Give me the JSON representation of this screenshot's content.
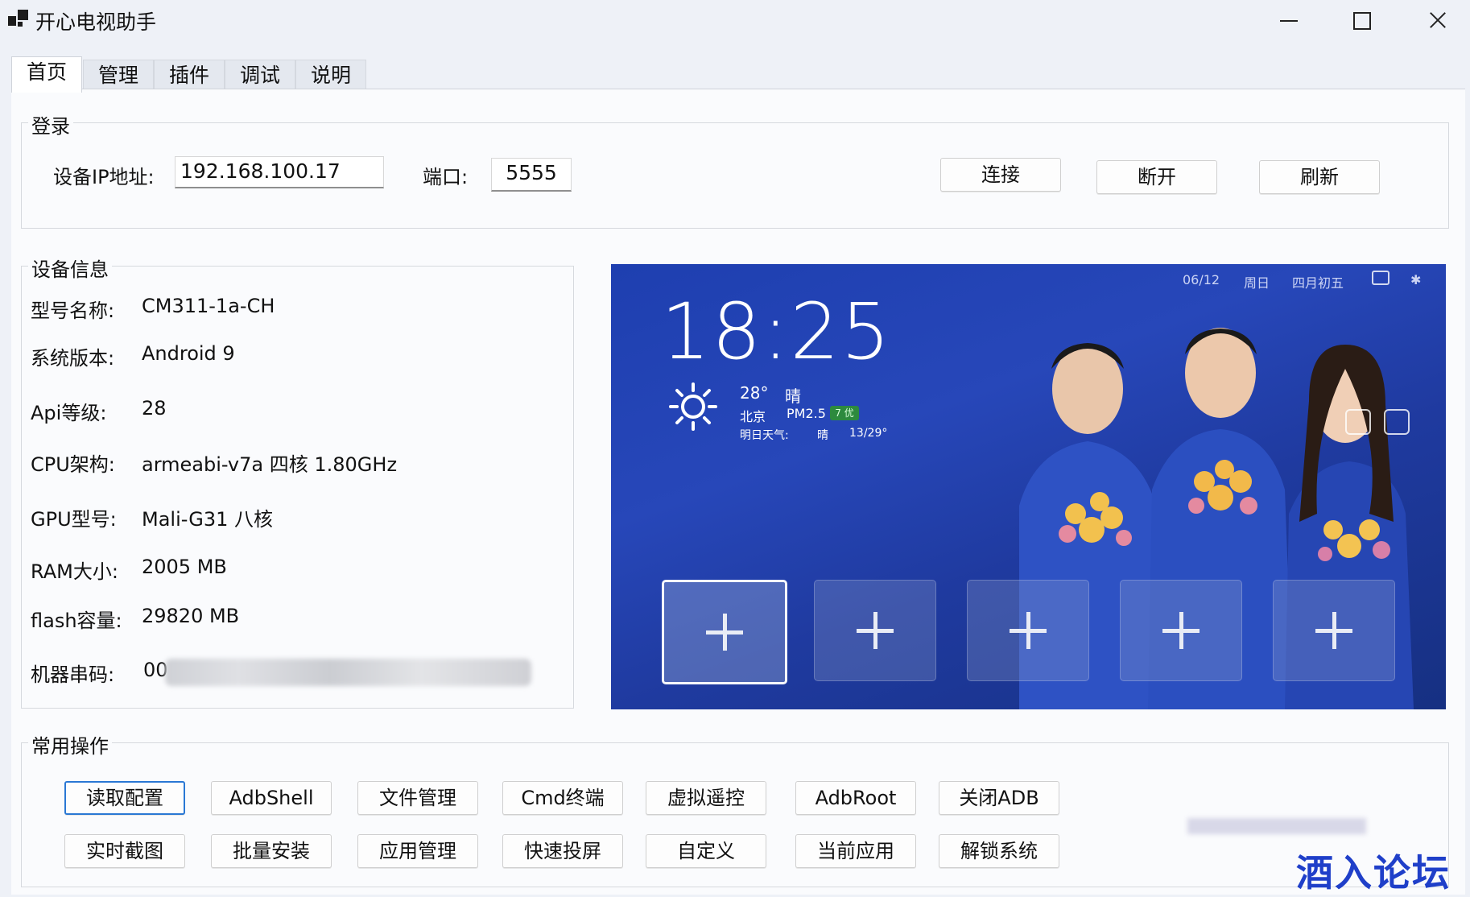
{
  "window": {
    "title": "开心电视助手"
  },
  "tabs": [
    {
      "label": "首页",
      "active": true
    },
    {
      "label": "管理",
      "active": false
    },
    {
      "label": "插件",
      "active": false
    },
    {
      "label": "调试",
      "active": false
    },
    {
      "label": "说明",
      "active": false
    }
  ],
  "login": {
    "group_title": "登录",
    "ip_label": "设备IP地址:",
    "ip_value": "192.168.100.17",
    "port_label": "端口:",
    "port_value": "5555",
    "connect_label": "连接",
    "disconnect_label": "断开",
    "refresh_label": "刷新"
  },
  "device_info": {
    "group_title": "设备信息",
    "rows": [
      {
        "label": "型号名称:",
        "value": "CM311-1a-CH"
      },
      {
        "label": "系统版本:",
        "value": "Android 9"
      },
      {
        "label": "Api等级:",
        "value": "28"
      },
      {
        "label": "CPU架构:",
        "value": "armeabi-v7a 四核 1.80GHz"
      },
      {
        "label": "GPU型号:",
        "value": "Mali-G31 八核"
      },
      {
        "label": "RAM大小:",
        "value": "2005 MB"
      },
      {
        "label": "flash容量:",
        "value": "29820 MB"
      },
      {
        "label": "机器串码:",
        "value": "00"
      }
    ]
  },
  "tv_screen": {
    "date": "06/12",
    "weekday": "周日",
    "lunar": "四月初五",
    "time": "18:25",
    "temp": "28°",
    "weather": "晴",
    "city": "北京",
    "pm_label": "PM2.5",
    "aqi": "7 优",
    "tomorrow_label": "明日天气:",
    "tomorrow_weather": "晴",
    "tomorrow_range": "13/29°"
  },
  "operations": {
    "group_title": "常用操作",
    "row1": [
      "读取配置",
      "AdbShell",
      "文件管理",
      "Cmd终端",
      "虚拟遥控",
      "AdbRoot",
      "关闭ADB"
    ],
    "row2": [
      "实时截图",
      "批量安装",
      "应用管理",
      "快速投屏",
      "自定义",
      "当前应用",
      "解锁系统"
    ]
  },
  "watermark": "酒入论坛",
  "colors": {
    "accent": "#2a78d4",
    "tv_bg": "#2747b9",
    "watermark": "#1f3fc9"
  }
}
